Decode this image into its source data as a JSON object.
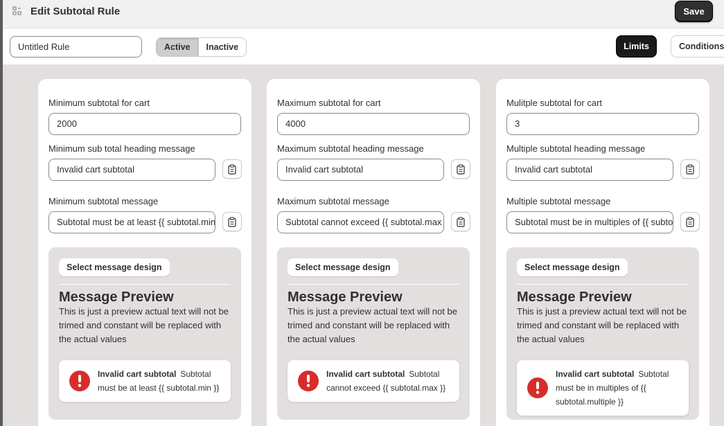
{
  "window": {
    "title": "Edit Subtotal Rule",
    "save_label": "Save",
    "app_icon": "grid-icon"
  },
  "toolbar": {
    "rule_name": "Untitled Rule",
    "status_options": [
      "Active",
      "Inactive"
    ],
    "status_selected": "Active",
    "tabs": [
      "Limits",
      "Conditions"
    ],
    "tab_selected": "Limits"
  },
  "cards": [
    {
      "value_label": "Minimum subtotal for cart",
      "value": "2000",
      "heading_label": "Minimum sub total heading message",
      "heading_value": "Invalid cart subtotal",
      "message_label": "Minimum subtotal message",
      "message_value": "Subtotal must be at least {{ subtotal.min }}",
      "design_button": "Select message design",
      "preview_heading": "Message Preview",
      "preview_note": "This is just a preview actual text will not be trimed and constant will be replaced with the actual values",
      "preview_title": "Invalid cart subtotal",
      "preview_body": "Subtotal must be at least {{ subtotal.min }}"
    },
    {
      "value_label": "Maximum subtotal for cart",
      "value": "4000",
      "heading_label": "Maximum subtotal heading message",
      "heading_value": "Invalid cart subtotal",
      "message_label": "Maximum subtotal message",
      "message_value": "Subtotal cannot exceed {{ subtotal.max }}",
      "design_button": "Select message design",
      "preview_heading": "Message Preview",
      "preview_note": "This is just a preview actual text will not be trimed and constant will be replaced with the actual values",
      "preview_title": "Invalid cart subtotal",
      "preview_body": "Subtotal cannot exceed {{ subtotal.max }}"
    },
    {
      "value_label": "Mulitple subtotal for cart",
      "value": "3",
      "heading_label": "Multiple subtotal heading message",
      "heading_value": "Invalid cart subtotal",
      "message_label": "Multiple subtotal message",
      "message_value": "Subtotal must be in multiples of {{ subtotal.multiple }}",
      "design_button": "Select message design",
      "preview_heading": "Message Preview",
      "preview_note": "This is just a preview actual text will not be trimed and constant will be replaced with the actual values",
      "preview_title": "Invalid cart subtotal",
      "preview_body": "Subtotal must be in multiples of {{ subtotal.multiple }}"
    }
  ],
  "colors": {
    "primary_button": "#303030",
    "page_background": "#e3dfdf",
    "error_icon": "#d82c2c"
  }
}
